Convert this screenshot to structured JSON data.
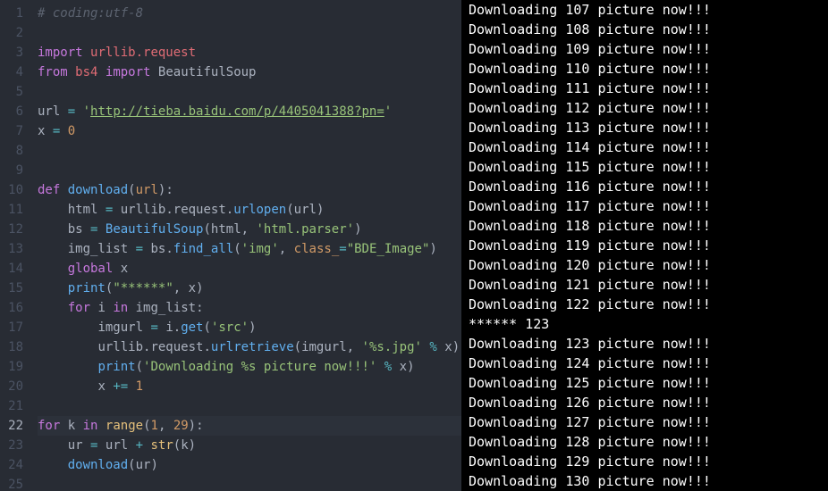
{
  "editor": {
    "active_line": 22,
    "lines": [
      {
        "n": 1,
        "tokens": [
          [
            "comment",
            "# coding:utf-8"
          ]
        ]
      },
      {
        "n": 2,
        "tokens": []
      },
      {
        "n": 3,
        "tokens": [
          [
            "keyword",
            "import"
          ],
          [
            "sp",
            " "
          ],
          [
            "module",
            "urllib.request"
          ]
        ]
      },
      {
        "n": 4,
        "tokens": [
          [
            "keyword",
            "from"
          ],
          [
            "sp",
            " "
          ],
          [
            "module",
            "bs4"
          ],
          [
            "sp",
            " "
          ],
          [
            "keyword",
            "import"
          ],
          [
            "sp",
            " "
          ],
          [
            "ident",
            "BeautifulSoup"
          ]
        ]
      },
      {
        "n": 5,
        "tokens": []
      },
      {
        "n": 6,
        "tokens": [
          [
            "ident",
            "url"
          ],
          [
            "sp",
            " "
          ],
          [
            "op",
            "="
          ],
          [
            "sp",
            " "
          ],
          [
            "string",
            "'"
          ],
          [
            "url",
            "http://tieba.baidu.com/p/4405041388?pn="
          ],
          [
            "string",
            "'"
          ]
        ]
      },
      {
        "n": 7,
        "tokens": [
          [
            "ident",
            "x"
          ],
          [
            "sp",
            " "
          ],
          [
            "op",
            "="
          ],
          [
            "sp",
            " "
          ],
          [
            "number",
            "0"
          ]
        ]
      },
      {
        "n": 8,
        "tokens": []
      },
      {
        "n": 9,
        "tokens": []
      },
      {
        "n": 10,
        "tokens": [
          [
            "keyword",
            "def"
          ],
          [
            "sp",
            " "
          ],
          [
            "func",
            "download"
          ],
          [
            "punc",
            "("
          ],
          [
            "param",
            "url"
          ],
          [
            "punc",
            ")"
          ],
          [
            "punc",
            ":"
          ]
        ]
      },
      {
        "n": 11,
        "tokens": [
          [
            "sp",
            "    "
          ],
          [
            "ident",
            "html"
          ],
          [
            "sp",
            " "
          ],
          [
            "op",
            "="
          ],
          [
            "sp",
            " "
          ],
          [
            "ident",
            "urllib"
          ],
          [
            "punc",
            "."
          ],
          [
            "ident",
            "request"
          ],
          [
            "punc",
            "."
          ],
          [
            "call",
            "urlopen"
          ],
          [
            "punc",
            "("
          ],
          [
            "ident",
            "url"
          ],
          [
            "punc",
            ")"
          ]
        ]
      },
      {
        "n": 12,
        "tokens": [
          [
            "sp",
            "    "
          ],
          [
            "ident",
            "bs"
          ],
          [
            "sp",
            " "
          ],
          [
            "op",
            "="
          ],
          [
            "sp",
            " "
          ],
          [
            "call",
            "BeautifulSoup"
          ],
          [
            "punc",
            "("
          ],
          [
            "ident",
            "html"
          ],
          [
            "punc",
            ","
          ],
          [
            "sp",
            " "
          ],
          [
            "string",
            "'html.parser'"
          ],
          [
            "punc",
            ")"
          ]
        ]
      },
      {
        "n": 13,
        "tokens": [
          [
            "sp",
            "    "
          ],
          [
            "ident",
            "img_list"
          ],
          [
            "sp",
            " "
          ],
          [
            "op",
            "="
          ],
          [
            "sp",
            " "
          ],
          [
            "ident",
            "bs"
          ],
          [
            "punc",
            "."
          ],
          [
            "call",
            "find_all"
          ],
          [
            "punc",
            "("
          ],
          [
            "string",
            "'img'"
          ],
          [
            "punc",
            ","
          ],
          [
            "sp",
            " "
          ],
          [
            "param",
            "class_"
          ],
          [
            "op",
            "="
          ],
          [
            "string",
            "\"BDE_Image\""
          ],
          [
            "punc",
            ")"
          ]
        ]
      },
      {
        "n": 14,
        "tokens": [
          [
            "sp",
            "    "
          ],
          [
            "keyword",
            "global"
          ],
          [
            "sp",
            " "
          ],
          [
            "ident",
            "x"
          ]
        ]
      },
      {
        "n": 15,
        "tokens": [
          [
            "sp",
            "    "
          ],
          [
            "call",
            "print"
          ],
          [
            "punc",
            "("
          ],
          [
            "string",
            "\"******\""
          ],
          [
            "punc",
            ","
          ],
          [
            "sp",
            " "
          ],
          [
            "ident",
            "x"
          ],
          [
            "punc",
            ")"
          ]
        ]
      },
      {
        "n": 16,
        "tokens": [
          [
            "sp",
            "    "
          ],
          [
            "keyword",
            "for"
          ],
          [
            "sp",
            " "
          ],
          [
            "ident",
            "i"
          ],
          [
            "sp",
            " "
          ],
          [
            "keyword",
            "in"
          ],
          [
            "sp",
            " "
          ],
          [
            "ident",
            "img_list"
          ],
          [
            "punc",
            ":"
          ]
        ]
      },
      {
        "n": 17,
        "tokens": [
          [
            "sp",
            "        "
          ],
          [
            "ident",
            "imgurl"
          ],
          [
            "sp",
            " "
          ],
          [
            "op",
            "="
          ],
          [
            "sp",
            " "
          ],
          [
            "ident",
            "i"
          ],
          [
            "punc",
            "."
          ],
          [
            "call",
            "get"
          ],
          [
            "punc",
            "("
          ],
          [
            "string",
            "'src'"
          ],
          [
            "punc",
            ")"
          ]
        ]
      },
      {
        "n": 18,
        "tokens": [
          [
            "sp",
            "        "
          ],
          [
            "ident",
            "urllib"
          ],
          [
            "punc",
            "."
          ],
          [
            "ident",
            "request"
          ],
          [
            "punc",
            "."
          ],
          [
            "call",
            "urlretrieve"
          ],
          [
            "punc",
            "("
          ],
          [
            "ident",
            "imgurl"
          ],
          [
            "punc",
            ","
          ],
          [
            "sp",
            " "
          ],
          [
            "string",
            "'%s.jpg'"
          ],
          [
            "sp",
            " "
          ],
          [
            "op",
            "%"
          ],
          [
            "sp",
            " "
          ],
          [
            "ident",
            "x"
          ],
          [
            "punc",
            ")"
          ]
        ]
      },
      {
        "n": 19,
        "tokens": [
          [
            "sp",
            "        "
          ],
          [
            "call",
            "print"
          ],
          [
            "punc",
            "("
          ],
          [
            "string",
            "'Downloading %s picture now!!!'"
          ],
          [
            "sp",
            " "
          ],
          [
            "op",
            "%"
          ],
          [
            "sp",
            " "
          ],
          [
            "ident",
            "x"
          ],
          [
            "punc",
            ")"
          ]
        ]
      },
      {
        "n": 20,
        "tokens": [
          [
            "sp",
            "        "
          ],
          [
            "ident",
            "x"
          ],
          [
            "sp",
            " "
          ],
          [
            "op",
            "+="
          ],
          [
            "sp",
            " "
          ],
          [
            "number",
            "1"
          ]
        ]
      },
      {
        "n": 21,
        "tokens": []
      },
      {
        "n": 22,
        "tokens": [
          [
            "keyword",
            "for"
          ],
          [
            "sp",
            " "
          ],
          [
            "ident",
            "k"
          ],
          [
            "sp",
            " "
          ],
          [
            "keyword",
            "in"
          ],
          [
            "sp",
            " "
          ],
          [
            "builtin",
            "range"
          ],
          [
            "punc",
            "("
          ],
          [
            "number",
            "1"
          ],
          [
            "punc",
            ","
          ],
          [
            "sp",
            " "
          ],
          [
            "number",
            "29"
          ],
          [
            "punc",
            ")"
          ],
          [
            "punc",
            ":"
          ]
        ]
      },
      {
        "n": 23,
        "tokens": [
          [
            "sp",
            "    "
          ],
          [
            "ident",
            "ur"
          ],
          [
            "sp",
            " "
          ],
          [
            "op",
            "="
          ],
          [
            "sp",
            " "
          ],
          [
            "ident",
            "url"
          ],
          [
            "sp",
            " "
          ],
          [
            "op",
            "+"
          ],
          [
            "sp",
            " "
          ],
          [
            "builtin",
            "str"
          ],
          [
            "punc",
            "("
          ],
          [
            "ident",
            "k"
          ],
          [
            "punc",
            ")"
          ]
        ]
      },
      {
        "n": 24,
        "tokens": [
          [
            "sp",
            "    "
          ],
          [
            "call",
            "download"
          ],
          [
            "punc",
            "("
          ],
          [
            "ident",
            "ur"
          ],
          [
            "punc",
            ")"
          ]
        ]
      },
      {
        "n": 25,
        "tokens": []
      }
    ]
  },
  "terminal": {
    "lines": [
      "Downloading 107 picture now!!!",
      "Downloading 108 picture now!!!",
      "Downloading 109 picture now!!!",
      "Downloading 110 picture now!!!",
      "Downloading 111 picture now!!!",
      "Downloading 112 picture now!!!",
      "Downloading 113 picture now!!!",
      "Downloading 114 picture now!!!",
      "Downloading 115 picture now!!!",
      "Downloading 116 picture now!!!",
      "Downloading 117 picture now!!!",
      "Downloading 118 picture now!!!",
      "Downloading 119 picture now!!!",
      "Downloading 120 picture now!!!",
      "Downloading 121 picture now!!!",
      "Downloading 122 picture now!!!",
      "****** 123",
      "Downloading 123 picture now!!!",
      "Downloading 124 picture now!!!",
      "Downloading 125 picture now!!!",
      "Downloading 126 picture now!!!",
      "Downloading 127 picture now!!!",
      "Downloading 128 picture now!!!",
      "Downloading 129 picture now!!!",
      "Downloading 130 picture now!!!"
    ]
  }
}
